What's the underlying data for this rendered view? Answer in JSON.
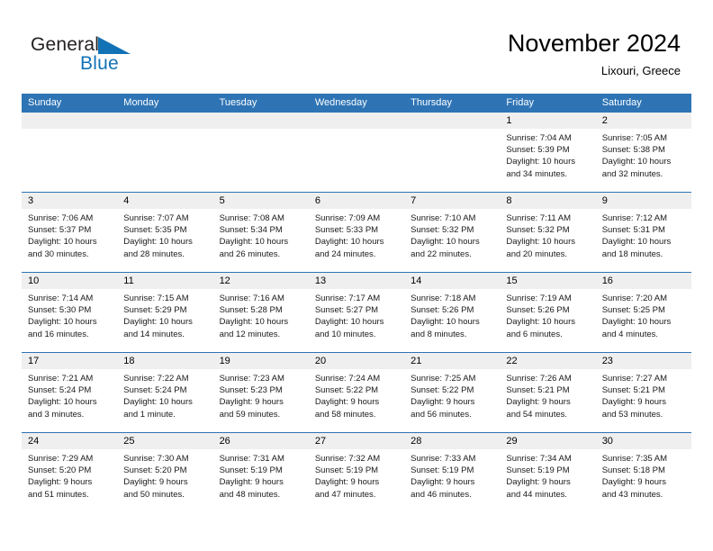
{
  "brand": {
    "name_part1": "General",
    "name_part2": "Blue"
  },
  "header": {
    "title": "November 2024",
    "subtitle": "Lixouri, Greece"
  },
  "colors": {
    "header_blue": "#2e74b5",
    "brand_blue": "#1272b6",
    "daynum_band": "#efefef"
  },
  "weekdays": [
    "Sunday",
    "Monday",
    "Tuesday",
    "Wednesday",
    "Thursday",
    "Friday",
    "Saturday"
  ],
  "weeks": [
    [
      {
        "day": "",
        "sunrise": "",
        "sunset": "",
        "daylight1": "",
        "daylight2": ""
      },
      {
        "day": "",
        "sunrise": "",
        "sunset": "",
        "daylight1": "",
        "daylight2": ""
      },
      {
        "day": "",
        "sunrise": "",
        "sunset": "",
        "daylight1": "",
        "daylight2": ""
      },
      {
        "day": "",
        "sunrise": "",
        "sunset": "",
        "daylight1": "",
        "daylight2": ""
      },
      {
        "day": "",
        "sunrise": "",
        "sunset": "",
        "daylight1": "",
        "daylight2": ""
      },
      {
        "day": "1",
        "sunrise": "Sunrise: 7:04 AM",
        "sunset": "Sunset: 5:39 PM",
        "daylight1": "Daylight: 10 hours",
        "daylight2": "and 34 minutes."
      },
      {
        "day": "2",
        "sunrise": "Sunrise: 7:05 AM",
        "sunset": "Sunset: 5:38 PM",
        "daylight1": "Daylight: 10 hours",
        "daylight2": "and 32 minutes."
      }
    ],
    [
      {
        "day": "3",
        "sunrise": "Sunrise: 7:06 AM",
        "sunset": "Sunset: 5:37 PM",
        "daylight1": "Daylight: 10 hours",
        "daylight2": "and 30 minutes."
      },
      {
        "day": "4",
        "sunrise": "Sunrise: 7:07 AM",
        "sunset": "Sunset: 5:35 PM",
        "daylight1": "Daylight: 10 hours",
        "daylight2": "and 28 minutes."
      },
      {
        "day": "5",
        "sunrise": "Sunrise: 7:08 AM",
        "sunset": "Sunset: 5:34 PM",
        "daylight1": "Daylight: 10 hours",
        "daylight2": "and 26 minutes."
      },
      {
        "day": "6",
        "sunrise": "Sunrise: 7:09 AM",
        "sunset": "Sunset: 5:33 PM",
        "daylight1": "Daylight: 10 hours",
        "daylight2": "and 24 minutes."
      },
      {
        "day": "7",
        "sunrise": "Sunrise: 7:10 AM",
        "sunset": "Sunset: 5:32 PM",
        "daylight1": "Daylight: 10 hours",
        "daylight2": "and 22 minutes."
      },
      {
        "day": "8",
        "sunrise": "Sunrise: 7:11 AM",
        "sunset": "Sunset: 5:32 PM",
        "daylight1": "Daylight: 10 hours",
        "daylight2": "and 20 minutes."
      },
      {
        "day": "9",
        "sunrise": "Sunrise: 7:12 AM",
        "sunset": "Sunset: 5:31 PM",
        "daylight1": "Daylight: 10 hours",
        "daylight2": "and 18 minutes."
      }
    ],
    [
      {
        "day": "10",
        "sunrise": "Sunrise: 7:14 AM",
        "sunset": "Sunset: 5:30 PM",
        "daylight1": "Daylight: 10 hours",
        "daylight2": "and 16 minutes."
      },
      {
        "day": "11",
        "sunrise": "Sunrise: 7:15 AM",
        "sunset": "Sunset: 5:29 PM",
        "daylight1": "Daylight: 10 hours",
        "daylight2": "and 14 minutes."
      },
      {
        "day": "12",
        "sunrise": "Sunrise: 7:16 AM",
        "sunset": "Sunset: 5:28 PM",
        "daylight1": "Daylight: 10 hours",
        "daylight2": "and 12 minutes."
      },
      {
        "day": "13",
        "sunrise": "Sunrise: 7:17 AM",
        "sunset": "Sunset: 5:27 PM",
        "daylight1": "Daylight: 10 hours",
        "daylight2": "and 10 minutes."
      },
      {
        "day": "14",
        "sunrise": "Sunrise: 7:18 AM",
        "sunset": "Sunset: 5:26 PM",
        "daylight1": "Daylight: 10 hours",
        "daylight2": "and 8 minutes."
      },
      {
        "day": "15",
        "sunrise": "Sunrise: 7:19 AM",
        "sunset": "Sunset: 5:26 PM",
        "daylight1": "Daylight: 10 hours",
        "daylight2": "and 6 minutes."
      },
      {
        "day": "16",
        "sunrise": "Sunrise: 7:20 AM",
        "sunset": "Sunset: 5:25 PM",
        "daylight1": "Daylight: 10 hours",
        "daylight2": "and 4 minutes."
      }
    ],
    [
      {
        "day": "17",
        "sunrise": "Sunrise: 7:21 AM",
        "sunset": "Sunset: 5:24 PM",
        "daylight1": "Daylight: 10 hours",
        "daylight2": "and 3 minutes."
      },
      {
        "day": "18",
        "sunrise": "Sunrise: 7:22 AM",
        "sunset": "Sunset: 5:24 PM",
        "daylight1": "Daylight: 10 hours",
        "daylight2": "and 1 minute."
      },
      {
        "day": "19",
        "sunrise": "Sunrise: 7:23 AM",
        "sunset": "Sunset: 5:23 PM",
        "daylight1": "Daylight: 9 hours",
        "daylight2": "and 59 minutes."
      },
      {
        "day": "20",
        "sunrise": "Sunrise: 7:24 AM",
        "sunset": "Sunset: 5:22 PM",
        "daylight1": "Daylight: 9 hours",
        "daylight2": "and 58 minutes."
      },
      {
        "day": "21",
        "sunrise": "Sunrise: 7:25 AM",
        "sunset": "Sunset: 5:22 PM",
        "daylight1": "Daylight: 9 hours",
        "daylight2": "and 56 minutes."
      },
      {
        "day": "22",
        "sunrise": "Sunrise: 7:26 AM",
        "sunset": "Sunset: 5:21 PM",
        "daylight1": "Daylight: 9 hours",
        "daylight2": "and 54 minutes."
      },
      {
        "day": "23",
        "sunrise": "Sunrise: 7:27 AM",
        "sunset": "Sunset: 5:21 PM",
        "daylight1": "Daylight: 9 hours",
        "daylight2": "and 53 minutes."
      }
    ],
    [
      {
        "day": "24",
        "sunrise": "Sunrise: 7:29 AM",
        "sunset": "Sunset: 5:20 PM",
        "daylight1": "Daylight: 9 hours",
        "daylight2": "and 51 minutes."
      },
      {
        "day": "25",
        "sunrise": "Sunrise: 7:30 AM",
        "sunset": "Sunset: 5:20 PM",
        "daylight1": "Daylight: 9 hours",
        "daylight2": "and 50 minutes."
      },
      {
        "day": "26",
        "sunrise": "Sunrise: 7:31 AM",
        "sunset": "Sunset: 5:19 PM",
        "daylight1": "Daylight: 9 hours",
        "daylight2": "and 48 minutes."
      },
      {
        "day": "27",
        "sunrise": "Sunrise: 7:32 AM",
        "sunset": "Sunset: 5:19 PM",
        "daylight1": "Daylight: 9 hours",
        "daylight2": "and 47 minutes."
      },
      {
        "day": "28",
        "sunrise": "Sunrise: 7:33 AM",
        "sunset": "Sunset: 5:19 PM",
        "daylight1": "Daylight: 9 hours",
        "daylight2": "and 46 minutes."
      },
      {
        "day": "29",
        "sunrise": "Sunrise: 7:34 AM",
        "sunset": "Sunset: 5:19 PM",
        "daylight1": "Daylight: 9 hours",
        "daylight2": "and 44 minutes."
      },
      {
        "day": "30",
        "sunrise": "Sunrise: 7:35 AM",
        "sunset": "Sunset: 5:18 PM",
        "daylight1": "Daylight: 9 hours",
        "daylight2": "and 43 minutes."
      }
    ]
  ]
}
